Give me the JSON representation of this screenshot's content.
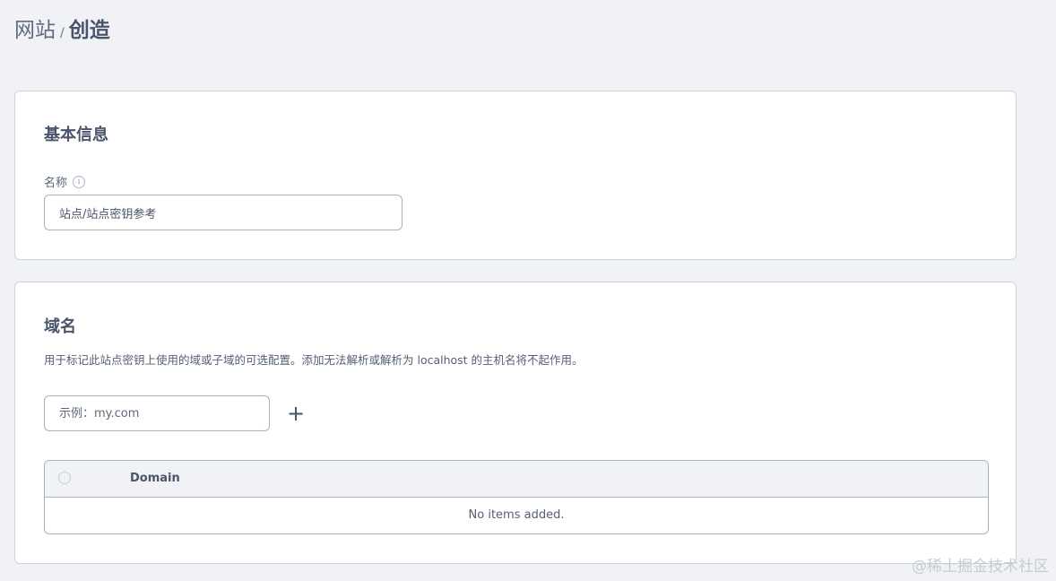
{
  "breadcrumb": {
    "parent": "网站",
    "separator": "/",
    "current": "创造"
  },
  "basic_info": {
    "title": "基本信息",
    "name_label": "名称",
    "info_icon": "info-icon",
    "name_value": "站点/站点密钥参考"
  },
  "domain": {
    "title": "域名",
    "description": "用于标记此站点密钥上使用的域或子域的可选配置。添加无法解析或解析为 localhost 的主机名将不起作用。",
    "input_placeholder": "示例：my.com",
    "add_icon": "+",
    "table": {
      "columns": [
        "Domain"
      ],
      "empty_text": "No items added."
    }
  },
  "watermark": "@稀土掘金技术社区"
}
